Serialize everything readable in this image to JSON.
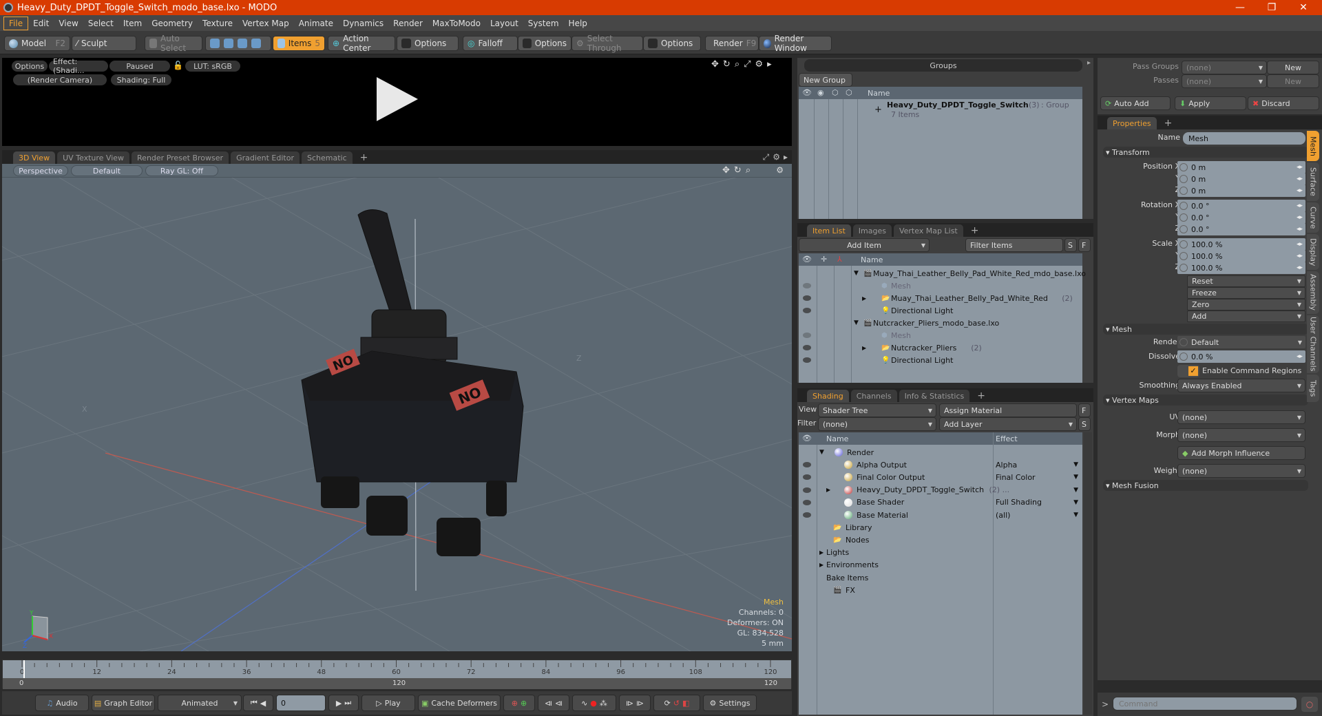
{
  "window": {
    "title": "Heavy_Duty_DPDT_Toggle_Switch_modo_base.lxo - MODO",
    "controls": {
      "minimize": "—",
      "restore": "❐",
      "close": "✕"
    }
  },
  "menu": [
    "File",
    "Edit",
    "View",
    "Select",
    "Item",
    "Geometry",
    "Texture",
    "Vertex Map",
    "Animate",
    "Dynamics",
    "Render",
    "MaxToModo",
    "Layout",
    "System",
    "Help"
  ],
  "toolbar": {
    "model": "Model",
    "model_key": "F2",
    "sculpt": "Sculpt",
    "auto_select": "Auto Select",
    "items": "Items",
    "items_key": "5",
    "action_center": "Action Center",
    "options1": "Options",
    "falloff": "Falloff",
    "options2": "Options",
    "select_through": "Select Through",
    "options3": "Options",
    "render": "Render",
    "render_key": "F9",
    "render_window": "Render Window"
  },
  "preview": {
    "options": "Options",
    "effect": "Effect: (Shadi...",
    "paused": "Paused",
    "lut": "LUT: sRGB",
    "camera": "(Render Camera)",
    "shading": "Shading: Full"
  },
  "viewport_tabs": [
    "3D View",
    "UV Texture View",
    "Render Preset Browser",
    "Gradient Editor",
    "Schematic"
  ],
  "viewport": {
    "projection": "Perspective",
    "style": "Default",
    "raygl": "Ray GL: Off",
    "stats": {
      "title": "Mesh",
      "channels": "Channels: 0",
      "deformers": "Deformers: ON",
      "gl": "GL: 834,528",
      "unit": "5 mm"
    },
    "axis": {
      "x": "X",
      "y": "Y",
      "z": "Z"
    },
    "model_label_left": "ON",
    "model_label_right": "ON"
  },
  "timeline": {
    "ticks": [
      "0",
      "12",
      "24",
      "36",
      "48",
      "60",
      "72",
      "84",
      "96",
      "108",
      "120"
    ],
    "range_start": "0",
    "range_mid": "120",
    "range_end": "120"
  },
  "transport": {
    "audio": "Audio",
    "graph_editor": "Graph Editor",
    "animated": "Animated",
    "frame": "0",
    "play": "Play",
    "cache_deformers": "Cache Deformers",
    "settings": "Settings"
  },
  "groups": {
    "title": "Groups",
    "new_group": "New Group",
    "col_name": "Name",
    "item": {
      "name": "Heavy_Duty_DPDT_Toggle_Switch",
      "count": "(3)",
      "type": ": Group",
      "sub": "7 Items"
    }
  },
  "item_list": {
    "tabs": [
      "Item List",
      "Images",
      "Vertex Map List"
    ],
    "add_item": "Add Item",
    "filter": "Filter Items",
    "s": "S",
    "f": "F",
    "col_name": "Name",
    "rows": [
      {
        "name": "Muay_Thai_Leather_Belly_Pad_White_Red_mdo_base.lxo",
        "level": 0,
        "kind": "scene"
      },
      {
        "name": "Mesh",
        "level": 1,
        "kind": "mesh"
      },
      {
        "name": "Muay_Thai_Leather_Belly_Pad_White_Red",
        "count": "(2)",
        "level": 1,
        "kind": "group"
      },
      {
        "name": "Directional Light",
        "level": 1,
        "kind": "light"
      },
      {
        "name": "Nutcracker_Pliers_modo_base.lxo",
        "level": 0,
        "kind": "scene"
      },
      {
        "name": "Mesh",
        "level": 1,
        "kind": "mesh"
      },
      {
        "name": "Nutcracker_Pliers",
        "count": "(2)",
        "level": 1,
        "kind": "group"
      },
      {
        "name": "Directional Light",
        "level": 1,
        "kind": "light"
      }
    ]
  },
  "shading": {
    "tabs": [
      "Shading",
      "Channels",
      "Info & Statistics"
    ],
    "view_label": "View",
    "view_value": "Shader Tree",
    "assign_material": "Assign Material",
    "f": "F",
    "filter_label": "Filter",
    "filter_value": "(none)",
    "add_layer": "Add Layer",
    "s": "S",
    "col_name": "Name",
    "col_effect": "Effect",
    "rows": [
      {
        "name": "Render",
        "effect": "",
        "level": 0,
        "icon": "#5a5ad8"
      },
      {
        "name": "Alpha Output",
        "effect": "Alpha",
        "level": 1,
        "icon": "#c8a030"
      },
      {
        "name": "Final Color Output",
        "effect": "Final Color",
        "level": 1,
        "icon": "#c8a030"
      },
      {
        "name": "Heavy_Duty_DPDT_Toggle_Switch",
        "count": "(2) ...",
        "effect": "",
        "level": 1,
        "icon": "#c03030"
      },
      {
        "name": "Base Shader",
        "effect": "Full Shading",
        "level": 1,
        "icon": "#dddddd"
      },
      {
        "name": "Base Material",
        "effect": "(all)",
        "level": 1,
        "icon": "#5aa870"
      },
      {
        "name": "Library",
        "effect": "",
        "level": 2,
        "icon": "folder"
      },
      {
        "name": "Nodes",
        "effect": "",
        "level": 2,
        "icon": "folder"
      },
      {
        "name": "Lights",
        "effect": "",
        "level": 3,
        "icon": ""
      },
      {
        "name": "Environments",
        "effect": "",
        "level": 3,
        "icon": ""
      },
      {
        "name": "Bake Items",
        "effect": "",
        "level": 4,
        "icon": ""
      },
      {
        "name": "FX",
        "effect": "",
        "level": 2,
        "icon": "clapper"
      }
    ]
  },
  "passes": {
    "pass_groups": "Pass Groups",
    "passes": "Passes",
    "none": "(none)",
    "new": "New",
    "auto_add": "Auto Add",
    "apply": "Apply",
    "discard": "Discard"
  },
  "properties": {
    "tab": "Properties",
    "name_label": "Name",
    "name_value": "Mesh",
    "transform": "Transform",
    "position": [
      {
        "l": "Position X",
        "v": "0 m"
      },
      {
        "l": "Y",
        "v": "0 m"
      },
      {
        "l": "Z",
        "v": "0 m"
      }
    ],
    "rotation": [
      {
        "l": "Rotation X",
        "v": "0.0 °"
      },
      {
        "l": "Y",
        "v": "0.0 °"
      },
      {
        "l": "Z",
        "v": "0.0 °"
      }
    ],
    "scale": [
      {
        "l": "Scale X",
        "v": "100.0 %"
      },
      {
        "l": "Y",
        "v": "100.0 %"
      },
      {
        "l": "Z",
        "v": "100.0 %"
      }
    ],
    "actions": [
      "Reset",
      "Freeze",
      "Zero",
      "Add"
    ],
    "mesh": "Mesh",
    "render_label": "Render",
    "render_value": "Default",
    "dissolve_label": "Dissolve",
    "dissolve_value": "0.0 %",
    "enable_cmd": "Enable Command Regions",
    "smoothing_label": "Smoothing",
    "smoothing_value": "Always Enabled",
    "vertex_maps": "Vertex Maps",
    "uv_label": "UV",
    "uv_value": "(none)",
    "morph_label": "Morph",
    "morph_value": "(none)",
    "add_morph": "Add Morph Influence",
    "weight_label": "Weight",
    "weight_value": "(none)",
    "mesh_fusion": "Mesh Fusion",
    "side_tabs": [
      "Mesh",
      "Surface",
      "Curve",
      "Display",
      "Assembly",
      "User Channels",
      "Tags"
    ]
  },
  "command": {
    "prompt": ">",
    "placeholder": "Command"
  },
  "colors": {
    "accent": "#f0a030",
    "titlebar": "#d83b01",
    "viewport": "#5c6872",
    "list": "#8d98a2"
  }
}
